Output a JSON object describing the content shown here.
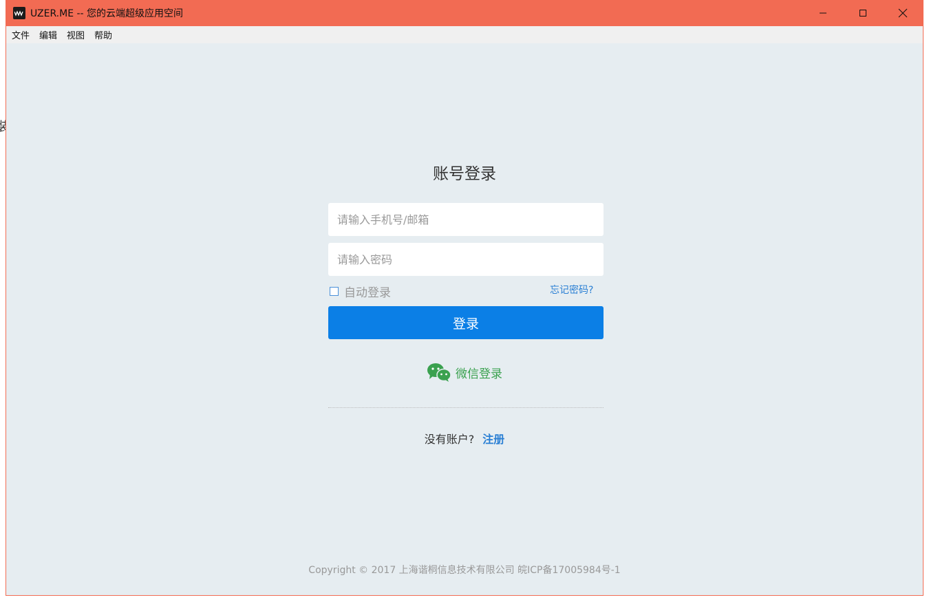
{
  "background_fragment": "装",
  "window": {
    "title": "UZER.ME -- 您的云端超级应用空间",
    "controls": [
      "minimize-icon",
      "maximize-icon",
      "close-icon"
    ]
  },
  "menubar": {
    "items": [
      "文件",
      "编辑",
      "视图",
      "帮助"
    ]
  },
  "login": {
    "title": "账号登录",
    "phone_placeholder": "请输入手机号/邮箱",
    "password_placeholder": "请输入密码",
    "auto_login_label": "自动登录",
    "forgot_password": "忘记密码?",
    "login_button": "登录",
    "wechat_login": "微信登录",
    "no_account": "没有账户?",
    "register": "注册"
  },
  "footer": {
    "copyright": "Copyright © 2017 上海谐桐信息技术有限公司 皖ICP备17005984号-1"
  },
  "colors": {
    "titlebar": "#f26b53",
    "content_bg": "#e6edf1",
    "primary": "#0b7fe6",
    "link": "#2a7fd4",
    "wechat": "#3aa14f"
  }
}
